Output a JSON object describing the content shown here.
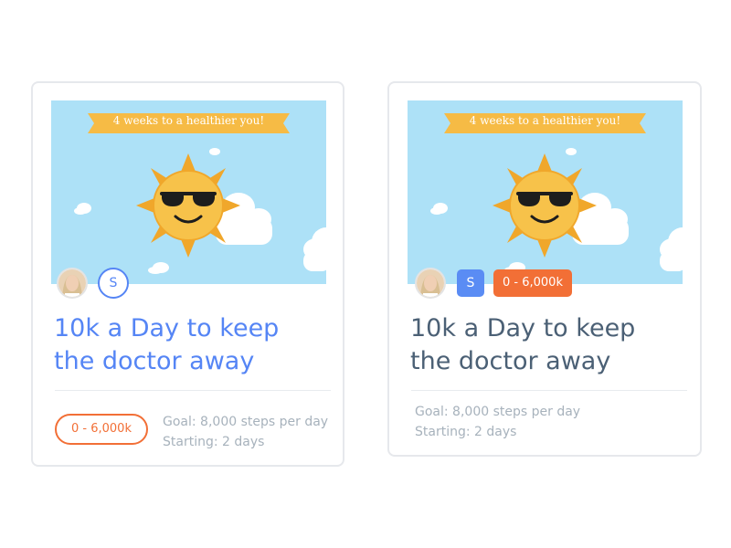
{
  "cards": [
    {
      "banner_text": "4 weeks to a healthier you!",
      "badge_letter": "S",
      "title_line1": "10k a Day to keep",
      "title_line2": "the doctor away",
      "range_label": "0 - 6,000k",
      "goal": "Goal: 8,000 steps per day",
      "starting": "Starting: 2 days"
    },
    {
      "banner_text": "4 weeks to a healthier you!",
      "badge_letter": "S",
      "title_line1": "10k a Day to keep",
      "title_line2": "the doctor away",
      "range_label": "0 - 6,000k",
      "goal": "Goal: 8,000 steps per day",
      "starting": "Starting: 2 days"
    }
  ],
  "colors": {
    "sky": "#ade1f7",
    "ribbon": "#f6bb45",
    "sun": "#f4b43a",
    "accent_blue": "#5585f5",
    "accent_orange": "#f26f36",
    "title_dark": "#4b6075",
    "meta_gray": "#a7b2bc"
  }
}
